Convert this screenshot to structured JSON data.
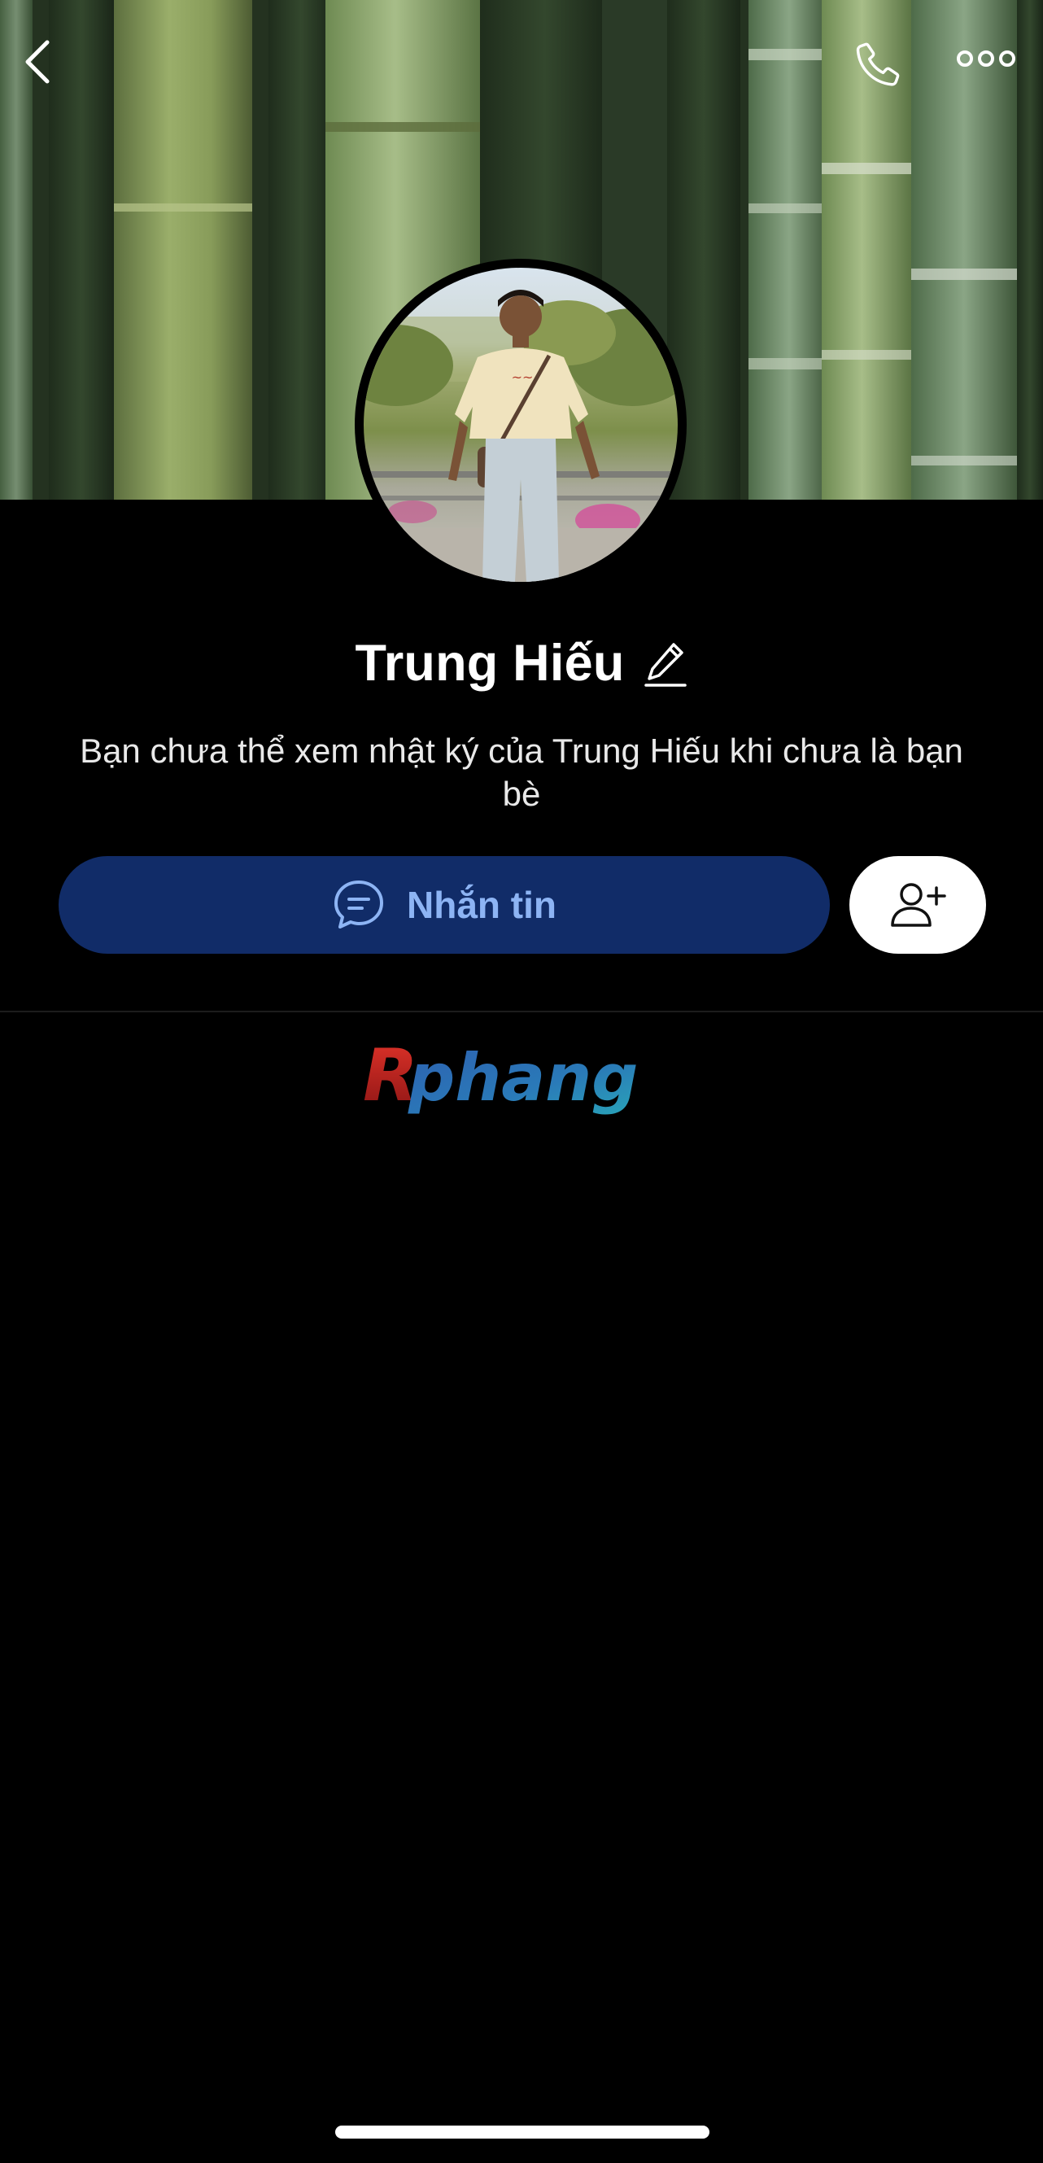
{
  "profile": {
    "name": "Trung Hiếu",
    "description": "Bạn chưa thể xem nhật ký của Trung Hiếu khi chưa là bạn bè"
  },
  "actions": {
    "message_label": "Nhắn tin"
  },
  "watermark": {
    "text": "Rphang"
  },
  "icons": {
    "back": "chevron-left-icon",
    "call": "phone-icon",
    "more": "more-dots-icon",
    "edit": "pencil-icon",
    "message": "chat-bubble-icon",
    "add_friend": "add-user-icon"
  },
  "colors": {
    "background": "#000000",
    "message_button_bg": "#112c68",
    "message_button_text": "#8db4f4",
    "add_button_bg": "#ffffff",
    "watermark_red": "#c8201e",
    "watermark_blue": "#2a7ab8"
  }
}
